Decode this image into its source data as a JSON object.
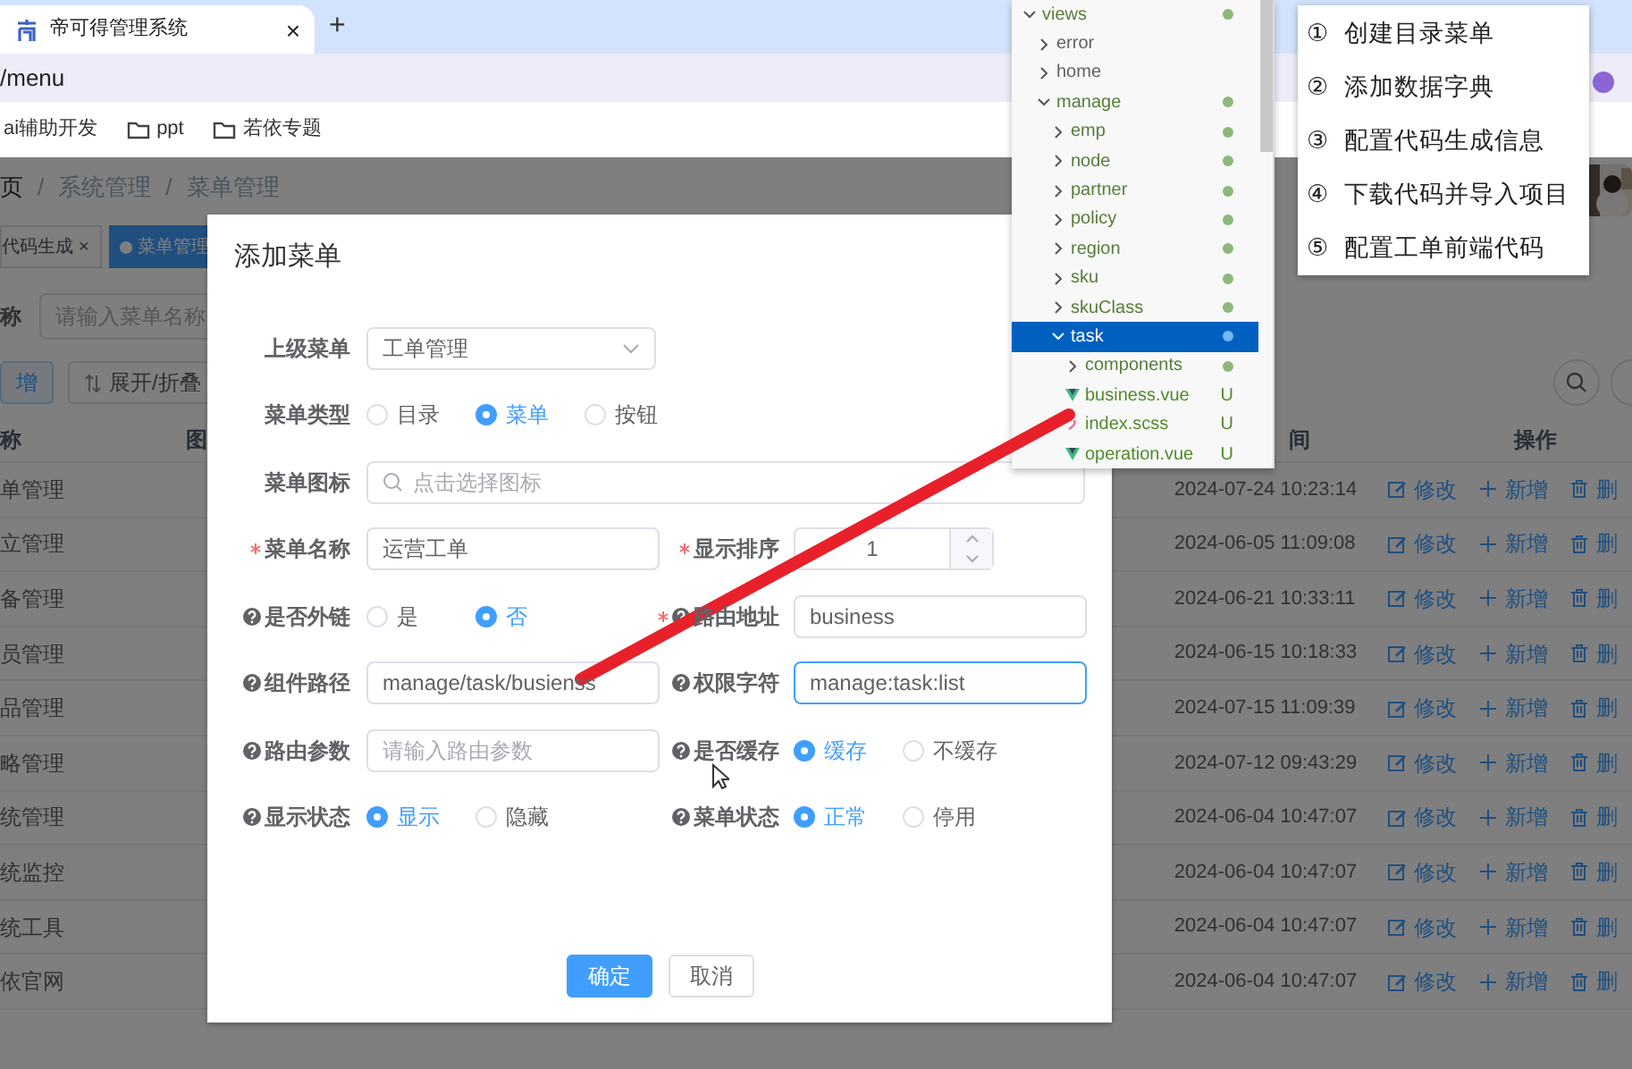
{
  "browser": {
    "tab": {
      "title": "帝可得管理系统",
      "close": "×"
    },
    "new_tab": "+",
    "address": "/menu",
    "bookmarks": [
      {
        "label": "ai辅助开发",
        "kind": "link"
      },
      {
        "label": "ppt",
        "kind": "folder"
      },
      {
        "label": "若依专题",
        "kind": "folder"
      }
    ]
  },
  "breadcrumb": {
    "items": [
      "页",
      "系统管理",
      "菜单管理"
    ],
    "separator": "/"
  },
  "tags": [
    {
      "label": "代码生成",
      "selected": false,
      "close": "×"
    },
    {
      "label": "菜单管理",
      "selected": true
    }
  ],
  "search": {
    "label": "称",
    "placeholder": "请输入菜单名称"
  },
  "toolbar": [
    {
      "label": "增",
      "kind": "primary"
    },
    {
      "label": "展开/折叠",
      "kind": "plain"
    }
  ],
  "table": {
    "columns": [
      "称",
      "图",
      "间",
      "操作"
    ],
    "rows": [
      {
        "name": "单管理",
        "time": "2024-07-24 10:23:14",
        "actions": [
          "修改",
          "新增",
          "删"
        ]
      },
      {
        "name": "立管理",
        "time": "2024-06-05 11:09:08",
        "actions": [
          "修改",
          "新增",
          "删"
        ]
      },
      {
        "name": "备管理",
        "time": "2024-06-21 10:33:11",
        "actions": [
          "修改",
          "新增",
          "删"
        ]
      },
      {
        "name": "员管理",
        "time": "2024-06-15 10:18:33",
        "actions": [
          "修改",
          "新增",
          "删"
        ]
      },
      {
        "name": "品管理",
        "time": "2024-07-15 11:09:39",
        "actions": [
          "修改",
          "新增",
          "删"
        ]
      },
      {
        "name": "略管理",
        "time": "2024-07-12 09:43:29",
        "actions": [
          "修改",
          "新增",
          "删"
        ]
      },
      {
        "name": "统管理",
        "time": "2024-06-04 10:47:07",
        "actions": [
          "修改",
          "新增",
          "删"
        ]
      },
      {
        "name": "统监控",
        "time": "2024-06-04 10:47:07",
        "actions": [
          "修改",
          "新增",
          "删"
        ]
      },
      {
        "name": "统工具",
        "time": "2024-06-04 10:47:07",
        "actions": [
          "修改",
          "新增",
          "删"
        ]
      },
      {
        "name": "依官网",
        "time": "2024-06-04 10:47:07",
        "actions": [
          "修改",
          "新增",
          "删"
        ]
      }
    ]
  },
  "dialog": {
    "title": "添加菜单",
    "rows": [
      [
        {
          "label": "上级菜单",
          "kind": "select",
          "required": false,
          "help": false,
          "value": "工单管理",
          "focused": false
        }
      ],
      [
        {
          "label": "菜单类型",
          "kind": "radio",
          "required": false,
          "help": false,
          "options": [
            {
              "label": "目录",
              "selected": false
            },
            {
              "label": "菜单",
              "selected": true
            },
            {
              "label": "按钮",
              "selected": false
            }
          ]
        }
      ],
      [
        {
          "label": "菜单图标",
          "kind": "icon-picker",
          "required": false,
          "help": false,
          "placeholder": "点击选择图标",
          "focused": false
        }
      ],
      [
        {
          "label": "菜单名称",
          "kind": "input",
          "required": true,
          "help": false,
          "value": "运营工单",
          "focused": false
        },
        {
          "label": "显示排序",
          "kind": "number",
          "required": true,
          "help": false,
          "value": "1",
          "focused": false
        }
      ],
      [
        {
          "label": "是否外链",
          "kind": "radio",
          "required": false,
          "help": true,
          "options": [
            {
              "label": "是",
              "selected": false
            },
            {
              "label": "否",
              "selected": true
            }
          ]
        },
        {
          "label": "路由地址",
          "kind": "input",
          "required": true,
          "help": true,
          "value": "business",
          "focused": false
        }
      ],
      [
        {
          "label": "组件路径",
          "kind": "input",
          "required": false,
          "help": true,
          "value": "manage/task/busienss",
          "focused": false
        },
        {
          "label": "权限字符",
          "kind": "input",
          "required": false,
          "help": true,
          "value": "manage:task:list",
          "focused": true
        }
      ],
      [
        {
          "label": "路由参数",
          "kind": "input",
          "required": false,
          "help": true,
          "placeholder": "请输入路由参数",
          "focused": false
        },
        {
          "label": "是否缓存",
          "kind": "radio",
          "required": false,
          "help": true,
          "options": [
            {
              "label": "缓存",
              "selected": true
            },
            {
              "label": "不缓存",
              "selected": false
            }
          ]
        }
      ],
      [
        {
          "label": "显示状态",
          "kind": "radio",
          "required": false,
          "help": true,
          "options": [
            {
              "label": "显示",
              "selected": true
            },
            {
              "label": "隐藏",
              "selected": false
            }
          ]
        },
        {
          "label": "菜单状态",
          "kind": "radio",
          "required": false,
          "help": true,
          "options": [
            {
              "label": "正常",
              "selected": true
            },
            {
              "label": "停用",
              "selected": false
            }
          ]
        }
      ]
    ],
    "buttons": [
      {
        "label": "确定",
        "kind": "primary"
      },
      {
        "label": "取消",
        "kind": "plain"
      }
    ]
  },
  "file_tree": [
    {
      "label": "views",
      "kind": "folder",
      "expanded": true,
      "selected": false,
      "changed": true,
      "children": [
        {
          "label": "error",
          "kind": "folder",
          "expanded": false,
          "selected": false,
          "changed": false
        },
        {
          "label": "home",
          "kind": "folder",
          "expanded": false,
          "selected": false,
          "changed": false
        },
        {
          "label": "manage",
          "kind": "folder",
          "expanded": true,
          "selected": false,
          "changed": true,
          "children": [
            {
              "label": "emp",
              "kind": "folder",
              "expanded": false,
              "selected": false,
              "changed": true
            },
            {
              "label": "node",
              "kind": "folder",
              "expanded": false,
              "selected": false,
              "changed": true
            },
            {
              "label": "partner",
              "kind": "folder",
              "expanded": false,
              "selected": false,
              "changed": true
            },
            {
              "label": "policy",
              "kind": "folder",
              "expanded": false,
              "selected": false,
              "changed": true
            },
            {
              "label": "region",
              "kind": "folder",
              "expanded": false,
              "selected": false,
              "changed": true
            },
            {
              "label": "sku",
              "kind": "folder",
              "expanded": false,
              "selected": false,
              "changed": true
            },
            {
              "label": "skuClass",
              "kind": "folder",
              "expanded": false,
              "selected": false,
              "changed": true
            },
            {
              "label": "task",
              "kind": "folder",
              "expanded": true,
              "selected": true,
              "changed": true,
              "children": [
                {
                  "label": "components",
                  "kind": "folder",
                  "expanded": false,
                  "selected": false,
                  "changed": true
                },
                {
                  "label": "business.vue",
                  "kind": "vue",
                  "selected": false,
                  "status": "U"
                },
                {
                  "label": "index.scss",
                  "kind": "scss",
                  "selected": false,
                  "status": "U"
                },
                {
                  "label": "operation.vue",
                  "kind": "vue",
                  "selected": false,
                  "status": "U"
                }
              ]
            }
          ]
        }
      ]
    }
  ],
  "steps": [
    {
      "number": "①",
      "text": "创建目录菜单"
    },
    {
      "number": "②",
      "text": "添加数据字典"
    },
    {
      "number": "③",
      "text": "配置代码生成信息"
    },
    {
      "number": "④",
      "text": "下载代码并导入项目"
    },
    {
      "number": "⑤",
      "text": "配置工单前端代码"
    }
  ]
}
